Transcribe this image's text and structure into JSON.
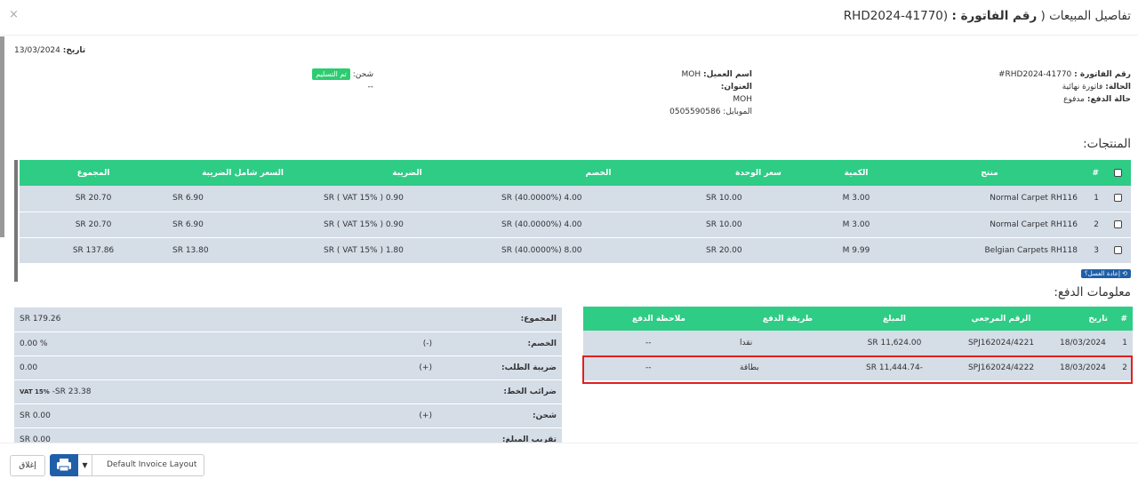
{
  "header": {
    "title_prefix": "تفاصيل المبيعات (",
    "title_invoice_label": "رقم الفاتورة :",
    "title_invoice_no": "RHD2024-41770)",
    "close_symbol": "×"
  },
  "date": {
    "label": "تاريخ:",
    "value": "13/03/2024"
  },
  "invoice": {
    "number_label": "رقم الفاتورة :",
    "number_value": "#RHD2024-41770",
    "status_label": "الحالة:",
    "status_value": "فاتورة نهائية",
    "payment_status_label": "حالة الدفع:",
    "payment_status_value": "مدفوع"
  },
  "customer": {
    "name_label": "اسم العميل:",
    "name_value": "MOH",
    "address_label": "العنوان:",
    "address_value": "MOH",
    "mobile_label": "الموبايل:",
    "mobile_value": "0505590586"
  },
  "shipping": {
    "label": "شحن:",
    "badge": "تم التسليم",
    "details": "--"
  },
  "products": {
    "section_title": "المنتجات:",
    "headers": [
      "#",
      "منتج",
      "الكمية",
      "سعر الوحدة",
      "الخصم",
      "الضريبة",
      "السعر شامل الضريبة",
      "المجموع"
    ],
    "rows": [
      {
        "n": "1",
        "product": "Normal Carpet RH116",
        "qty": "3.00 M",
        "unit_price": "SR 10.00",
        "discount": "SR (40.0000%) 4.00",
        "tax": "SR ( VAT 15% ) 0.90",
        "price_inc_tax": "SR 6.90",
        "total": "SR 20.70"
      },
      {
        "n": "2",
        "product": "Normal Carpet RH116",
        "qty": "3.00 M",
        "unit_price": "SR 10.00",
        "discount": "SR (40.0000%) 4.00",
        "tax": "SR ( VAT 15% ) 0.90",
        "price_inc_tax": "SR 6.90",
        "total": "SR 20.70"
      },
      {
        "n": "3",
        "product": "Belgian Carpets RH118",
        "qty": "9.99 M",
        "unit_price": "SR 20.00",
        "discount": "SR (40.0000%) 8.00",
        "tax": "SR ( VAT 15% ) 1.80",
        "price_inc_tax": "SR 13.80",
        "total": "SR 137.86"
      }
    ],
    "reset_button": "إعادة الغسل؟"
  },
  "payments": {
    "section_title": "معلومات الدفع:",
    "headers": [
      "#",
      "تاريخ",
      "الرقم المرجعي",
      "المبلغ",
      "طريقة الدفع",
      "ملاحظة الدفع"
    ],
    "rows": [
      {
        "n": "1",
        "date": "18/03/2024",
        "ref": "SPJ162024/4221",
        "amount": "SR 11,624.00",
        "method": "نقدا",
        "note": "--"
      },
      {
        "n": "2",
        "date": "18/03/2024",
        "ref": "SPJ162024/4222",
        "amount": "-SR 11,444.74",
        "method": "بطاقة",
        "note": "--"
      }
    ]
  },
  "totals": {
    "rows": [
      {
        "label": "المجموع:",
        "op": "",
        "value": "SR 179.26"
      },
      {
        "label": "الخصم:",
        "op": "(-)",
        "value": "% 0.00"
      },
      {
        "label": "ضريبة الطلب:",
        "op": "(+)",
        "value": "0.00"
      },
      {
        "label": "ضرائب الخط:",
        "op": "",
        "value": "-SR 23.38",
        "value_suffix": "VAT 15%"
      },
      {
        "label": "شحن:",
        "op": "(+)",
        "value": "SR 0.00"
      },
      {
        "label": "تقريب المبلغ:",
        "op": "",
        "value": "SR 0.00"
      }
    ]
  },
  "footer": {
    "close_button": "إغلاق",
    "layout_select": "Default Invoice Layout"
  },
  "colors": {
    "table_header_green": "#2ecc85",
    "row_bg": "#d5dde7",
    "primary_blue": "#1f5fa8",
    "highlight_red": "#e02020",
    "badge_green": "#2ecc71"
  }
}
